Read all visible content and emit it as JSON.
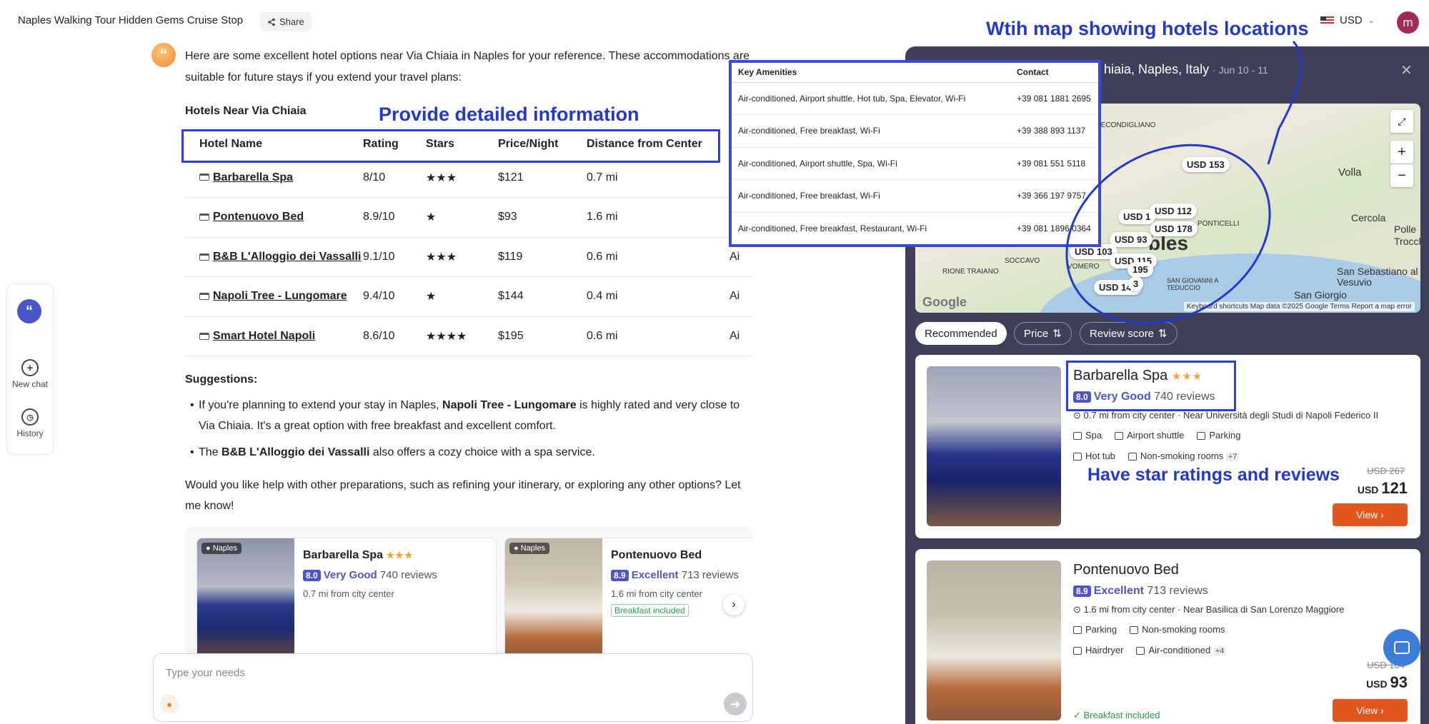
{
  "topbar": {
    "title": "Naples Walking Tour Hidden Gems Cruise Stop",
    "share_label": "Share",
    "currency": "USD",
    "avatar_letter": "m"
  },
  "chat": {
    "intro": "Here are some excellent hotel options near Via Chiaia in Naples for your reference. These accommodations are suitable for future stays if you extend your travel plans:",
    "section_title": "Hotels Near Via Chiaia",
    "table_headers": [
      "Hotel Name",
      "Rating",
      "Stars",
      "Price/Night",
      "Distance from Center"
    ],
    "rows": [
      {
        "name": "Barbarella Spa",
        "rating": "8/10",
        "stars": "★★★",
        "price": "$121",
        "distance": "0.7 mi",
        "extra": ""
      },
      {
        "name": "Pontenuovo Bed",
        "rating": "8.9/10",
        "stars": "★",
        "price": "$93",
        "distance": "1.6 mi",
        "extra": ""
      },
      {
        "name": "B&B L'Alloggio dei Vassalli",
        "rating": "9.1/10",
        "stars": "★★★",
        "price": "$119",
        "distance": "0.6 mi",
        "extra": "Ai"
      },
      {
        "name": "Napoli Tree - Lungomare",
        "rating": "9.4/10",
        "stars": "★",
        "price": "$144",
        "distance": "0.4 mi",
        "extra": "Ai"
      },
      {
        "name": "Smart Hotel Napoli",
        "rating": "8.6/10",
        "stars": "★★★★",
        "price": "$195",
        "distance": "0.6 mi",
        "extra": "Ai"
      }
    ],
    "suggestions_title": "Suggestions:",
    "suggestion1_pre": "If you're planning to extend your stay in Naples, ",
    "suggestion1_bold": "Napoli Tree - Lungomare",
    "suggestion1_post": " is highly rated and very close to Via Chiaia. It's a great option with free breakfast and excellent comfort.",
    "suggestion2_pre": "The ",
    "suggestion2_bold": "B&B L'Alloggio dei Vassalli",
    "suggestion2_post": " also offers a cozy choice with a spa service.",
    "closing": "Would you like help with other preparations, such as refining your itinerary, or exploring any other options? Let me know!",
    "cards": [
      {
        "tag": "Naples",
        "name": "Barbarella Spa",
        "stars": "★★★",
        "score": "8.0",
        "label": "Very Good",
        "reviews": "740 reviews",
        "distance": "0.7 mi from city center",
        "chip": ""
      },
      {
        "tag": "Naples",
        "name": "Pontenuovo Bed",
        "stars": "",
        "score": "8.9",
        "label": "Excellent",
        "reviews": "713 reviews",
        "distance": "1.6 mi from city center",
        "chip": "Breakfast included"
      }
    ],
    "input_placeholder": "Type your needs"
  },
  "sidebar": {
    "logo": "“",
    "new_chat": "New chat",
    "history": "History"
  },
  "amenities_table": {
    "headers": [
      "Key Amenities",
      "Contact"
    ],
    "rows": [
      {
        "amenities": "Air-conditioned, Airport shuttle, Hot tub, Spa, Elevator, Wi-Fi",
        "contact": "+39 081 1881 2695"
      },
      {
        "amenities": "Air-conditioned, Free breakfast, Wi-Fi",
        "contact": "+39 388 893 1137"
      },
      {
        "amenities": "Air-conditioned, Airport shuttle, Spa, Wi-Fi",
        "contact": "+39 081 551 5118"
      },
      {
        "amenities": "Air-conditioned, Free breakfast, Wi-Fi",
        "contact": "+39 366 197 9757"
      },
      {
        "amenities": "Air-conditioned, Free breakfast, Restaurant, Wi-Fi",
        "contact": "+39 081 1896 0364"
      }
    ]
  },
  "panel": {
    "location": "hiaia, Naples, Italy",
    "dates": "Jun 10 - 11",
    "map": {
      "labels": [
        "SECONDIGLIANO",
        "Volla",
        "Cercola",
        "Polle",
        "Trocch",
        "PONTICELLI",
        "SOCCAVO",
        "RIONE TRAIANO",
        "VOMERO",
        "bles",
        "SAN GIOVANNI A TEDUCCIO",
        "San Sebastiano al Vesuvio",
        "San Giorgio"
      ],
      "pins": [
        "USD 153",
        "USD 112",
        "USD 178",
        "USD 1",
        "USD 93",
        "USD 103",
        "USD 115",
        "195",
        "USD 144",
        "3"
      ],
      "footer": "Keyboard shortcuts   Map data ©2025 Google   Terms   Report a map error",
      "google": "Google"
    },
    "sort": {
      "recommended": "Recommended",
      "price": "Price",
      "review": "Review score"
    },
    "hotels": [
      {
        "name": "Barbarella Spa",
        "stars": "★★★",
        "score": "8.0",
        "label": "Very Good",
        "reviews": "740 reviews",
        "distance": "0.7 mi from city center",
        "near": "Near Università degli Studi di Napoli Federico II",
        "amenities_row1": [
          "Spa",
          "Airport shuttle",
          "Parking"
        ],
        "amenities_row2": [
          "Hot tub",
          "Non-smoking rooms"
        ],
        "more": "+7",
        "old_price": "USD 267",
        "currency": "USD",
        "price": "121",
        "view": "View",
        "breakfast": ""
      },
      {
        "name": "Pontenuovo Bed",
        "stars": "",
        "score": "8.9",
        "label": "Excellent",
        "reviews": "713 reviews",
        "distance": "1.6 mi from city center",
        "near": "Near Basilica di San Lorenzo Maggiore",
        "amenities_row1": [
          "Parking",
          "Non-smoking rooms"
        ],
        "amenities_row2": [
          "Hairdryer",
          "Air-conditioned"
        ],
        "more": "+4",
        "old_price": "USD 104",
        "currency": "USD",
        "price": "93",
        "view": "View",
        "breakfast": "Breakfast included"
      }
    ]
  },
  "annotations": {
    "map_note": "Wtih map showing hotels locations",
    "detail_note": "Provide detailed information",
    "stars_note": "Have star ratings and reviews"
  },
  "colors": {
    "accent": "#4f55c7",
    "cta": "#e2571b",
    "annotation": "#2438cc",
    "panel_bg": "#3d4058"
  }
}
